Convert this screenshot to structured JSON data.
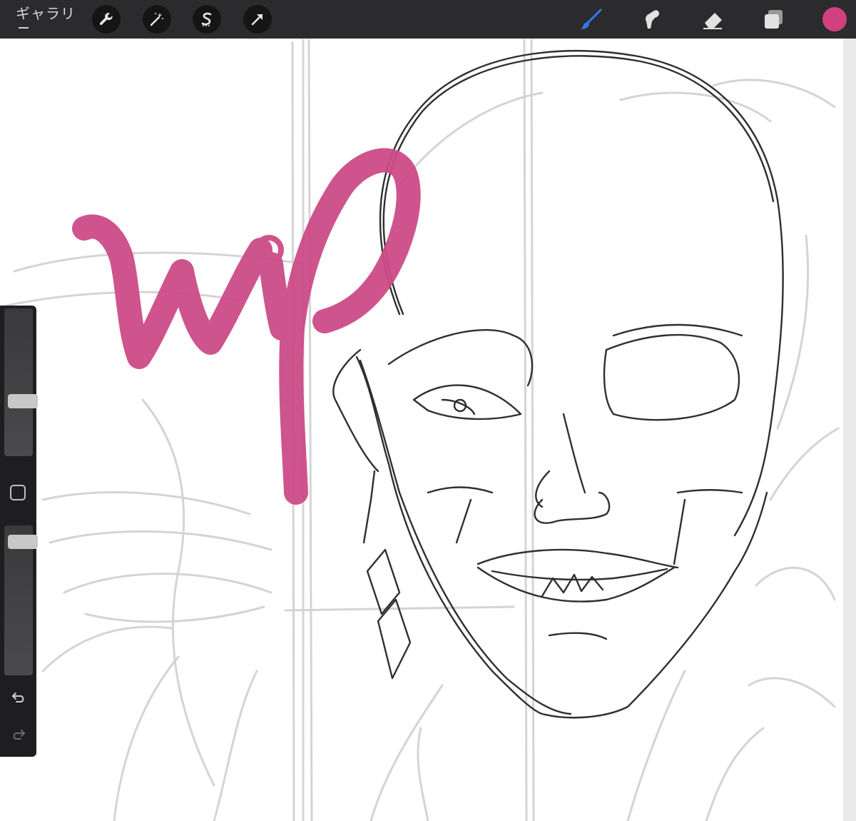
{
  "toolbar": {
    "gallery_label": "ギャラリ",
    "left_tools": [
      {
        "name": "actions",
        "icon": "wrench-icon"
      },
      {
        "name": "adjustments",
        "icon": "magic-wand-icon"
      },
      {
        "name": "selection",
        "icon": "selection-s-icon"
      },
      {
        "name": "transform",
        "icon": "arrow-cursor-icon"
      }
    ],
    "right_tools": [
      {
        "name": "brush",
        "icon": "brush-icon",
        "active": true
      },
      {
        "name": "smudge",
        "icon": "smudge-icon",
        "active": false
      },
      {
        "name": "eraser",
        "icon": "eraser-icon",
        "active": false
      },
      {
        "name": "layers",
        "icon": "layers-icon",
        "active": false
      }
    ],
    "current_color": "#d1407f",
    "active_tool_color": "#2f7cf6"
  },
  "canvas": {
    "watermark_text": "wip",
    "watermark_color": "#cc4b87"
  },
  "sidebar": {
    "brush_size_level": 0.35,
    "opacity_level": 0.95,
    "undo_icon": "undo-icon",
    "redo_icon": "redo-icon"
  }
}
